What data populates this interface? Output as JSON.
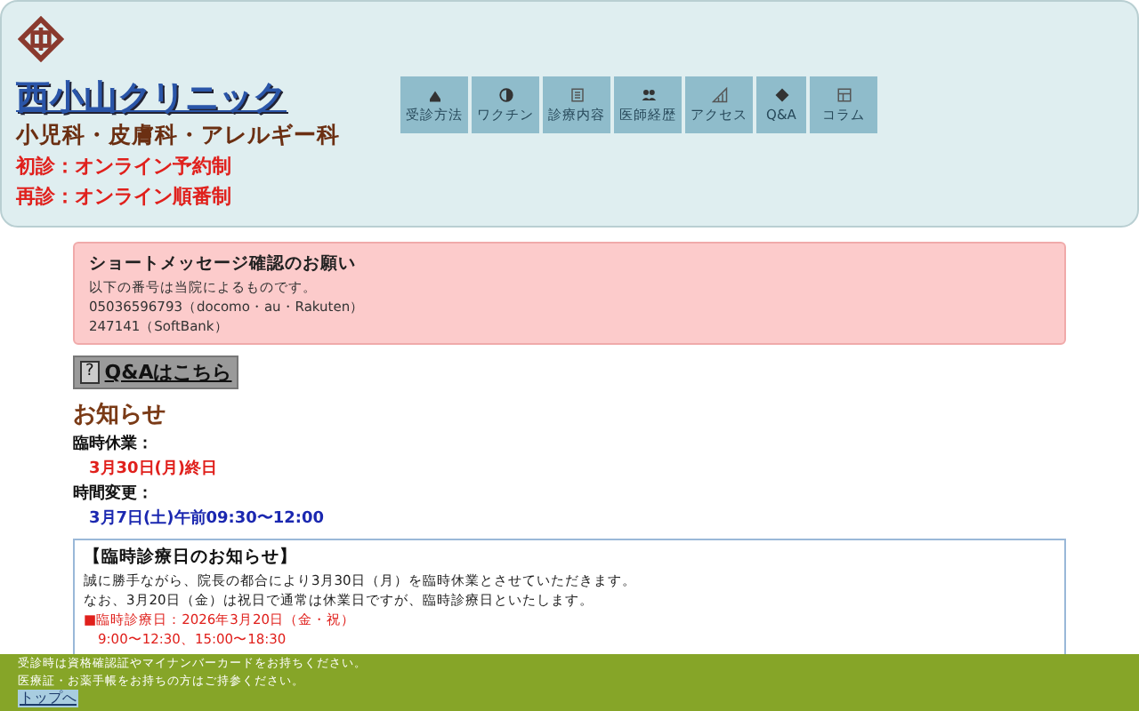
{
  "header": {
    "clinic_name": "西小山クリニック",
    "departments": "小児科・皮膚科・アレルギー科",
    "booking": [
      "初診：オンライン予約制",
      "再診：オンライン順番制"
    ]
  },
  "nav": [
    {
      "kind": "home",
      "label": "受診方法"
    },
    {
      "kind": "shield",
      "label": "ワクチン"
    },
    {
      "kind": "doc",
      "label": "診療内容"
    },
    {
      "kind": "people",
      "label": "医師経歴"
    },
    {
      "kind": "chart",
      "label": "アクセス"
    },
    {
      "kind": "diamond",
      "label": "Q&A"
    },
    {
      "kind": "panel",
      "label": "コラム"
    }
  ],
  "sms_notice": {
    "title": "ショートメッセージ確認のお願い",
    "lines": [
      "以下の番号は当院によるものです。",
      "05036596793（docomo・au・Rakuten）",
      "247141（SoftBank）"
    ]
  },
  "qa_button": {
    "icon": "?",
    "label": "Q&Aはこちら"
  },
  "news": {
    "heading": "お知らせ",
    "items": [
      {
        "label": "臨時休業：",
        "value": "3月30日(月)終日",
        "kind": "closed"
      },
      {
        "label": "時間変更：",
        "value": "3月7日(土)午前09:30〜12:00",
        "kind": "change"
      }
    ]
  },
  "notice_box": {
    "title": "【臨時診療日のお知らせ】",
    "lines": [
      "誠に勝手ながら、院長の都合により3月30日（月）を臨時休業とさせていただきます。",
      "なお、3月20日（金）は祝日で通常は休業日ですが、臨時診療日といたします。"
    ],
    "special": [
      "■臨時診療日：2026年3月20日（金・祝）",
      "9:00〜12:30、15:00〜18:30"
    ]
  },
  "footer": {
    "lines": [
      "受診時は資格確認証やマイナンバーカードをお持ちください。",
      "医療証・お薬手帳をお持ちの方はご持参ください。"
    ],
    "top_link": "トップへ"
  }
}
